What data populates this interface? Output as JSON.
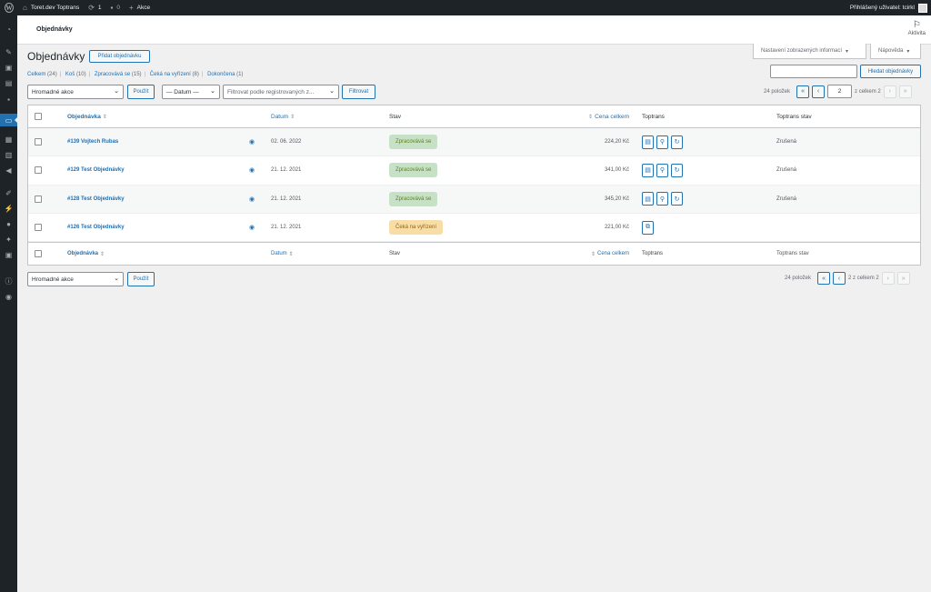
{
  "adminbar": {
    "site_name": "Toret.dev Toptrans",
    "updates_count": "1",
    "comments_count": "0",
    "new_label": "Akce",
    "user_label": "Přihlášený uživatel: tcirkl"
  },
  "header": {
    "title": "Objednávky",
    "activity_label": "Aktivita"
  },
  "screen_meta": {
    "options_label": "Nastavení zobrazených informací",
    "help_label": "Nápověda"
  },
  "page": {
    "heading": "Objednávky",
    "add_button": "Přidat objednávku"
  },
  "views": [
    {
      "label": "Celkem",
      "count": "(24)"
    },
    {
      "label": "Koš",
      "count": "(10)"
    },
    {
      "label": "Zpracovává se",
      "count": "(15)"
    },
    {
      "label": "Čeká na vyřízení",
      "count": "(8)"
    },
    {
      "label": "Dokončena",
      "count": "(1)"
    }
  ],
  "search": {
    "button": "Hledat objednávky",
    "value": ""
  },
  "filters": {
    "bulk_action": "Hromadné akce",
    "apply": "Použít",
    "date": "— Datum —",
    "customer_placeholder": "Filtrovat podle registrovaných z...",
    "filter_button": "Filtrovat"
  },
  "pagination_top": {
    "items": "24 položek",
    "first": "«",
    "prev": "‹",
    "current": "2",
    "total": "z celkem 2",
    "next": "›",
    "last": "»"
  },
  "pagination_bottom": {
    "items": "24 položek",
    "first": "«",
    "prev": "‹",
    "current": "2 z celkem 2",
    "next": "›",
    "last": "»"
  },
  "table": {
    "columns": {
      "order": "Objednávka",
      "date": "Datum",
      "status": "Stav",
      "total": "Cena celkem",
      "toptrans": "Toptrans",
      "toptrans_state": "Toptrans stav"
    },
    "rows": [
      {
        "order": "#139 Vojtech Rubas",
        "date": "02. 06. 2022",
        "status": "Zpracovává se",
        "status_type": "processing",
        "total": "224,20 Kč",
        "toptrans_state": "Zrušená",
        "tt_buttons": [
          "document-icon",
          "search-icon",
          "refresh-icon"
        ]
      },
      {
        "order": "#129 Test Objednávky",
        "date": "21. 12. 2021",
        "status": "Zpracovává se",
        "status_type": "processing",
        "total": "341,00 Kč",
        "toptrans_state": "Zrušená",
        "tt_buttons": [
          "document-icon",
          "search-icon",
          "refresh-icon"
        ]
      },
      {
        "order": "#128 Test Objednávky",
        "date": "21. 12. 2021",
        "status": "Zpracovává se",
        "status_type": "processing",
        "total": "345,20 Kč",
        "toptrans_state": "Zrušená",
        "tt_buttons": [
          "document-icon",
          "search-icon",
          "refresh-icon"
        ]
      },
      {
        "order": "#126 Test Objednávky",
        "date": "21. 12. 2021",
        "status": "Čeká na vyřízení",
        "status_type": "onhold",
        "total": "221,00 Kč",
        "toptrans_state": "",
        "tt_buttons": [
          "export-icon"
        ]
      }
    ]
  },
  "colors": {
    "accent": "#2271b1",
    "admin_bar": "#1d2327",
    "processing_bg": "#c6e1c6",
    "onhold_bg": "#f8dda7"
  }
}
